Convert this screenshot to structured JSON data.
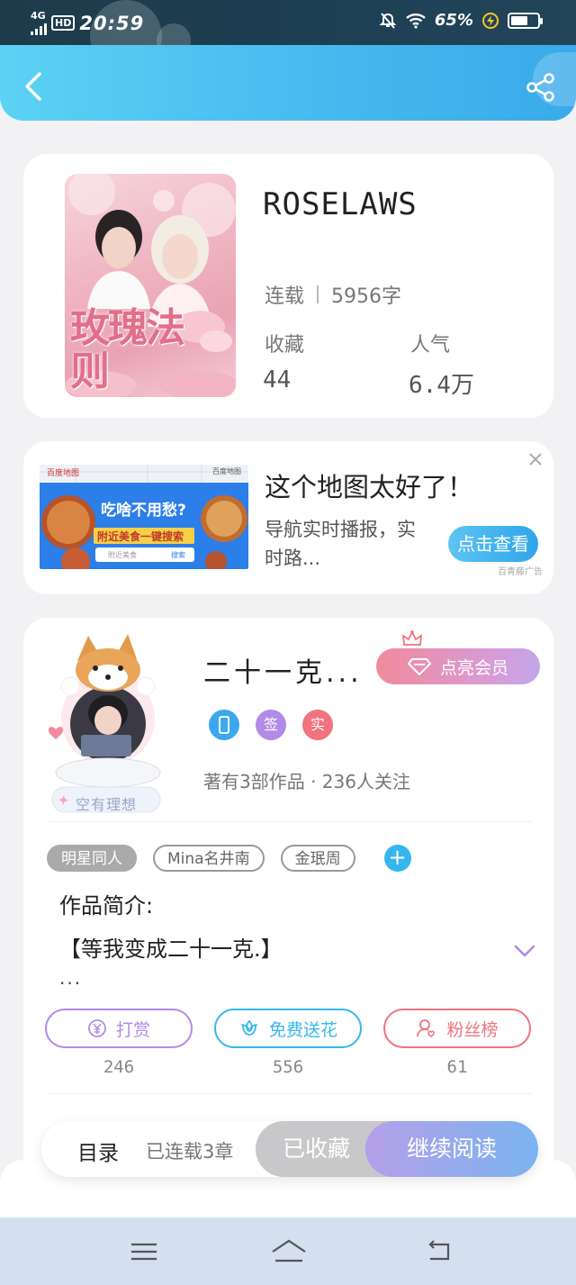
{
  "status_bar": {
    "network": "4G",
    "hd": "HD",
    "time": "20:59",
    "battery": "65%",
    "battery_level": 0.65,
    "icons": [
      "signal-icon",
      "hd-icon",
      "mute-bell-icon",
      "wifi-icon",
      "charging-icon",
      "battery-icon"
    ]
  },
  "header": {
    "icons": [
      "back-arrow-icon",
      "share-icon"
    ],
    "gradient": [
      "#5cd2f4",
      "#3aaaea"
    ]
  },
  "book": {
    "title": "ROSELAWS",
    "status": "连载",
    "word_count": "5956字",
    "favorites_label": "收藏",
    "favorites_value": "44",
    "popularity_label": "人气",
    "popularity_value": "6.4万",
    "cover_title": "玫瑰法则"
  },
  "ad": {
    "title": "这个地图太好了！",
    "description": "导航实时播报，实时路...",
    "button": "点击查看",
    "source": "百青藤广告",
    "image_headline": "吃啥不用愁?",
    "image_subline": "附近美食一键搜索",
    "image_brand": "百度地图",
    "image_search": "附近美食",
    "image_search_button": "搜索",
    "image_download": "百度地图"
  },
  "author": {
    "name": "二十一克...",
    "vip_button": "点亮会员",
    "badges": [
      {
        "label": "",
        "icon": "phone-badge-icon",
        "color": "#3aa8ef"
      },
      {
        "label": "签",
        "icon": "signed-badge-icon",
        "color": "#b18be6"
      },
      {
        "label": "实",
        "icon": "verified-badge-icon",
        "color": "#f0737d"
      }
    ],
    "stats": "著有3部作品 · 236人关注",
    "avatar_caption": "空有理想"
  },
  "tags": {
    "items": [
      "明星同人",
      "Mina名井南",
      "金珉周"
    ],
    "add_label": "+"
  },
  "intro": {
    "label": "作品简介:",
    "text": "【等我变成二十一克.】",
    "more": "..."
  },
  "actions": [
    {
      "label": "打赏",
      "count": "246",
      "icon": "yen-icon",
      "color": "#b18be6"
    },
    {
      "label": "免费送花",
      "count": "556",
      "icon": "flower-icon",
      "color": "#36b7ec"
    },
    {
      "label": "粉丝榜",
      "count": "61",
      "icon": "fans-icon",
      "color": "#f0737d"
    }
  ],
  "bottom_bar": {
    "toc": "目录",
    "progress": "已连载3章",
    "favorited": "已收藏",
    "continue": "继续阅读"
  },
  "nav": {
    "icons": [
      "menu-icon",
      "home-icon",
      "back-icon"
    ]
  }
}
